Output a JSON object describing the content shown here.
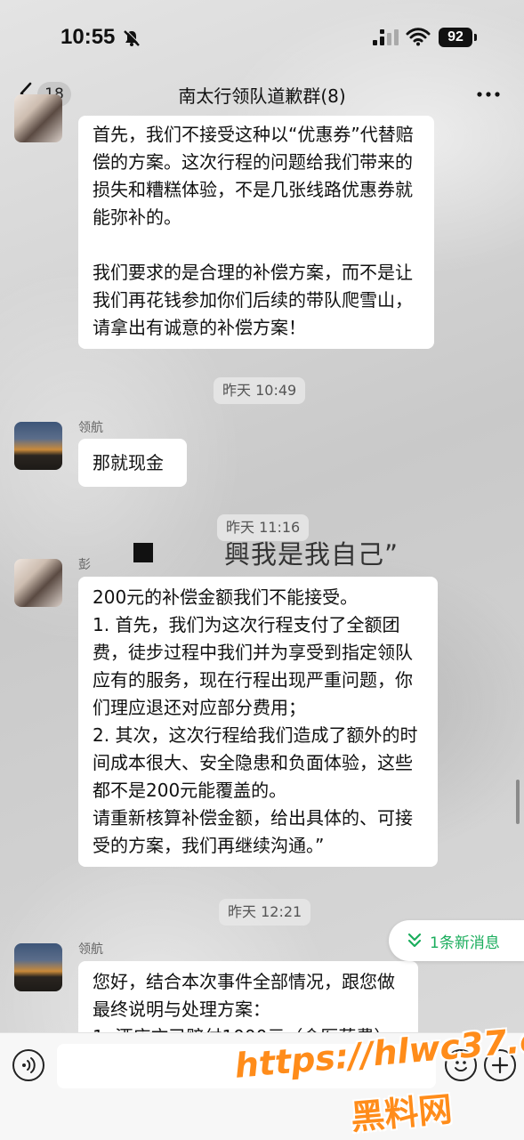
{
  "status_bar": {
    "time": "10:55",
    "battery": "92"
  },
  "nav": {
    "unread_count": "18",
    "title": "南太行领队道歉群(8)"
  },
  "messages": [
    {
      "sender": "",
      "paragraphs": [
        "首先，我们不接受这种以“优惠券”代替赔偿的方案。这次行程的问题给我们带来的损失和糟糕体验，不是几张线路优惠券就能弥补的。",
        "我们要求的是合理的补偿方案，而不是让我们再花钱参加你们后续的带队爬雪山，请拿出有诚意的补偿方案！"
      ]
    },
    {
      "timestamp": "昨天 10:49"
    },
    {
      "sender": "领航",
      "paragraphs": [
        "那就现金"
      ]
    },
    {
      "timestamp": "昨天 11:16"
    },
    {
      "sender": "彭",
      "paragraphs": [
        "200元的补偿金额我们不能接受。",
        "1. 首先，我们为这次行程支付了全额团费，徒步过程中我们并为享受到指定领队应有的服务，现在行程出现严重问题，你们理应退还对应部分费用；",
        "2. 其次，这次行程给我们造成了额外的时间成本很大、安全隐患和负面体验，这些都不是200元能覆盖的。",
        "请重新核算补偿金额，给出具体的、可接受的方案，我们再继续沟通。”"
      ]
    },
    {
      "timestamp": "昨天 12:21"
    },
    {
      "sender": "领航",
      "paragraphs": [
        "您好，结合本次事件全部情况，跟您做最终说明与处理方案：",
        "1. 酒店方已赔付1000元（含医药费）"
      ]
    }
  ],
  "overlay_text": "興我是我自己”",
  "new_messages_label": "1条新消息",
  "watermark": {
    "url": "https://hlwc37.com",
    "name": "黑料网"
  }
}
